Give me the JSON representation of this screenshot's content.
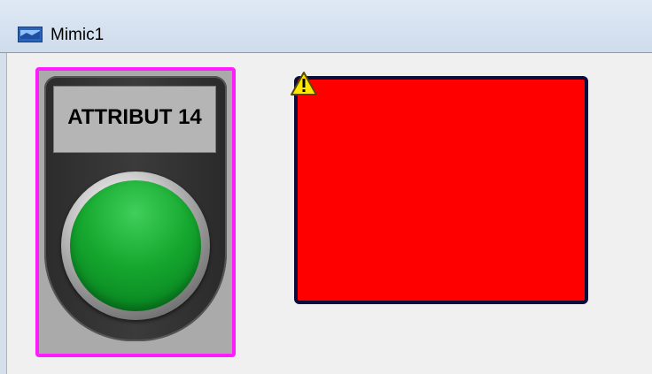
{
  "window": {
    "title": "Mimic1",
    "icon": "mimic-window-icon"
  },
  "mimic": {
    "pushbutton": {
      "label": "ATTRIBUT 14",
      "state_color": "#10a52a",
      "selection_color": "#ff1cff"
    },
    "indicator_rect": {
      "fill_color": "#ff0000",
      "border_color": "#0b0c3b",
      "badge_icon": "warning-icon"
    }
  }
}
